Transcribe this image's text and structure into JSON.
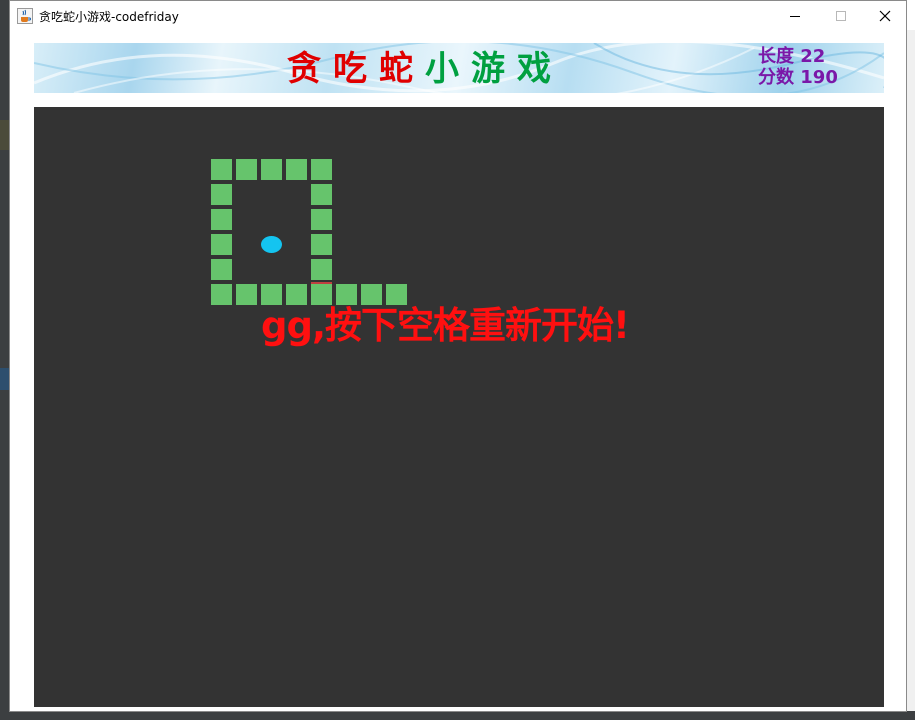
{
  "window": {
    "title": "贪吃蛇小游戏-codefriday",
    "icon": "java-cup-icon",
    "controls": [
      "minimize-icon",
      "maximize-icon",
      "close-icon"
    ]
  },
  "banner": {
    "title_chars": [
      "贪",
      "吃",
      "蛇",
      "小",
      "游",
      "戏"
    ],
    "title_colors": [
      "#e00000",
      "#e00000",
      "#e00000",
      "#00a040",
      "#00a040",
      "#00a040"
    ],
    "length_label": "长度 22",
    "score_label": "分数 190",
    "stats_color": "#7a18a8"
  },
  "game": {
    "background": "#333333",
    "snake_color": "#66c46c",
    "food_color": "#14c4f0",
    "snake_length": 22,
    "score": 190,
    "game_over_text": "gg,按下空格重新开始!",
    "game_over_color": "#ff1010"
  }
}
